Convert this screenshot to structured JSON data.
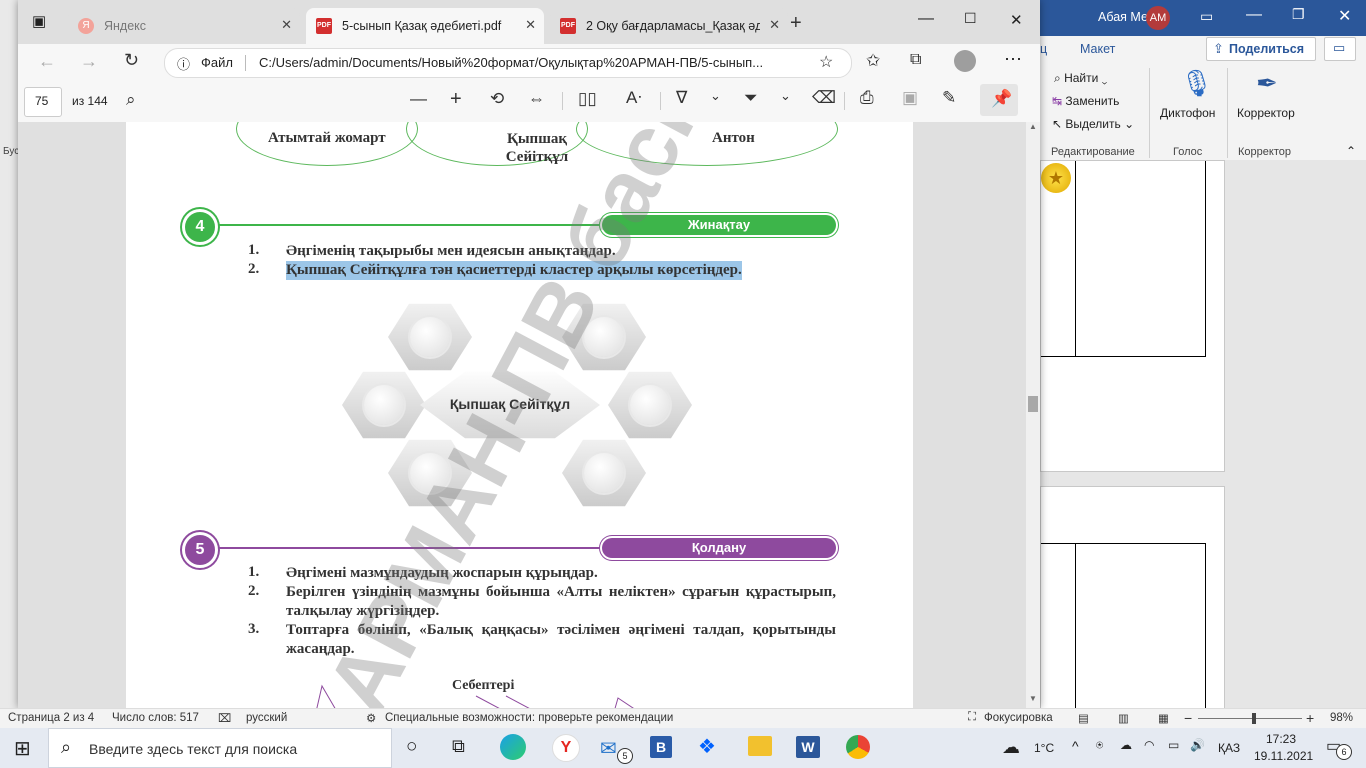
{
  "word": {
    "user_name": "Абая Мечта",
    "user_initials": "AM",
    "tabs": {
      "partial": "ц",
      "layout": "Макет"
    },
    "share_label": "Поделиться",
    "editing": {
      "find": "Найти",
      "replace": "Заменить",
      "select": "Выделить",
      "group": "Редактирование"
    },
    "voice": {
      "dictate": "Диктофон",
      "group": "Голос"
    },
    "editor": {
      "label": "Корректор",
      "group": "Корректор"
    },
    "left_edge_text": "Бус"
  },
  "edge": {
    "tabs": [
      {
        "label": "Яндекс"
      },
      {
        "label": "5-сынып Қазақ әдебиеті.pdf"
      },
      {
        "label": "2 Оқу бағдарламасы_Қазақ әде"
      }
    ],
    "address": {
      "scheme_label": "Файл",
      "url": "C:/Users/admin/Documents/Новый%20формат/Оқулықтар%20АРМАН-ПВ/5-сынып..."
    },
    "pdf_toolbar": {
      "page_current": "75",
      "page_total": "из 144"
    }
  },
  "pdf": {
    "ovals": [
      "Атымтай жомарт",
      "Қыпшақ Сейітқұл",
      "Антон"
    ],
    "section4": {
      "number": "4",
      "title": "Жинақтау",
      "color": "#3db54a",
      "items": [
        {
          "num": "1.",
          "text": "Әңгіменің тақырыбы мен идеясын анықтаңдар."
        },
        {
          "num": "2.",
          "text": "Қыпшақ Сейітқұлға тән қасиеттерді кластер арқылы көрсетіңдер."
        }
      ]
    },
    "cluster_center": "Қыпшақ Сейітқұл",
    "section5": {
      "number": "5",
      "title": "Қолдану",
      "color": "#8e4a9e",
      "items": [
        {
          "num": "1.",
          "text": "Әңгімені мазмұндаудың жоспарын құрыңдар."
        },
        {
          "num": "2.",
          "text": "Берілген үзіндінің мазмұны бойынша «Алты неліктен» сұрағын құрастырып, талқылау жүргізіңдер."
        },
        {
          "num": "3.",
          "text": "Топтарға бөлініп, «Балық қаңқасы» тәсілімен әңгімені талдап, қорытынды жасаңдар."
        }
      ]
    },
    "fishbone_label": "Себептері",
    "watermark": "АРМАН-ПВ баспа"
  },
  "status": {
    "page": "Страница 2 из 4",
    "words": "Число слов: 517",
    "language": "русский",
    "accessibility": "Специальные возможности: проверьте рекомендации",
    "focus": "Фокусировка",
    "zoom": "98%"
  },
  "taskbar": {
    "search_placeholder": "Введите здесь текст для поиска",
    "mail_badge": "5",
    "weather": "1°C",
    "lang": "ҚАЗ",
    "time": "17:23",
    "date": "19.11.2021",
    "notif_count": "6"
  }
}
